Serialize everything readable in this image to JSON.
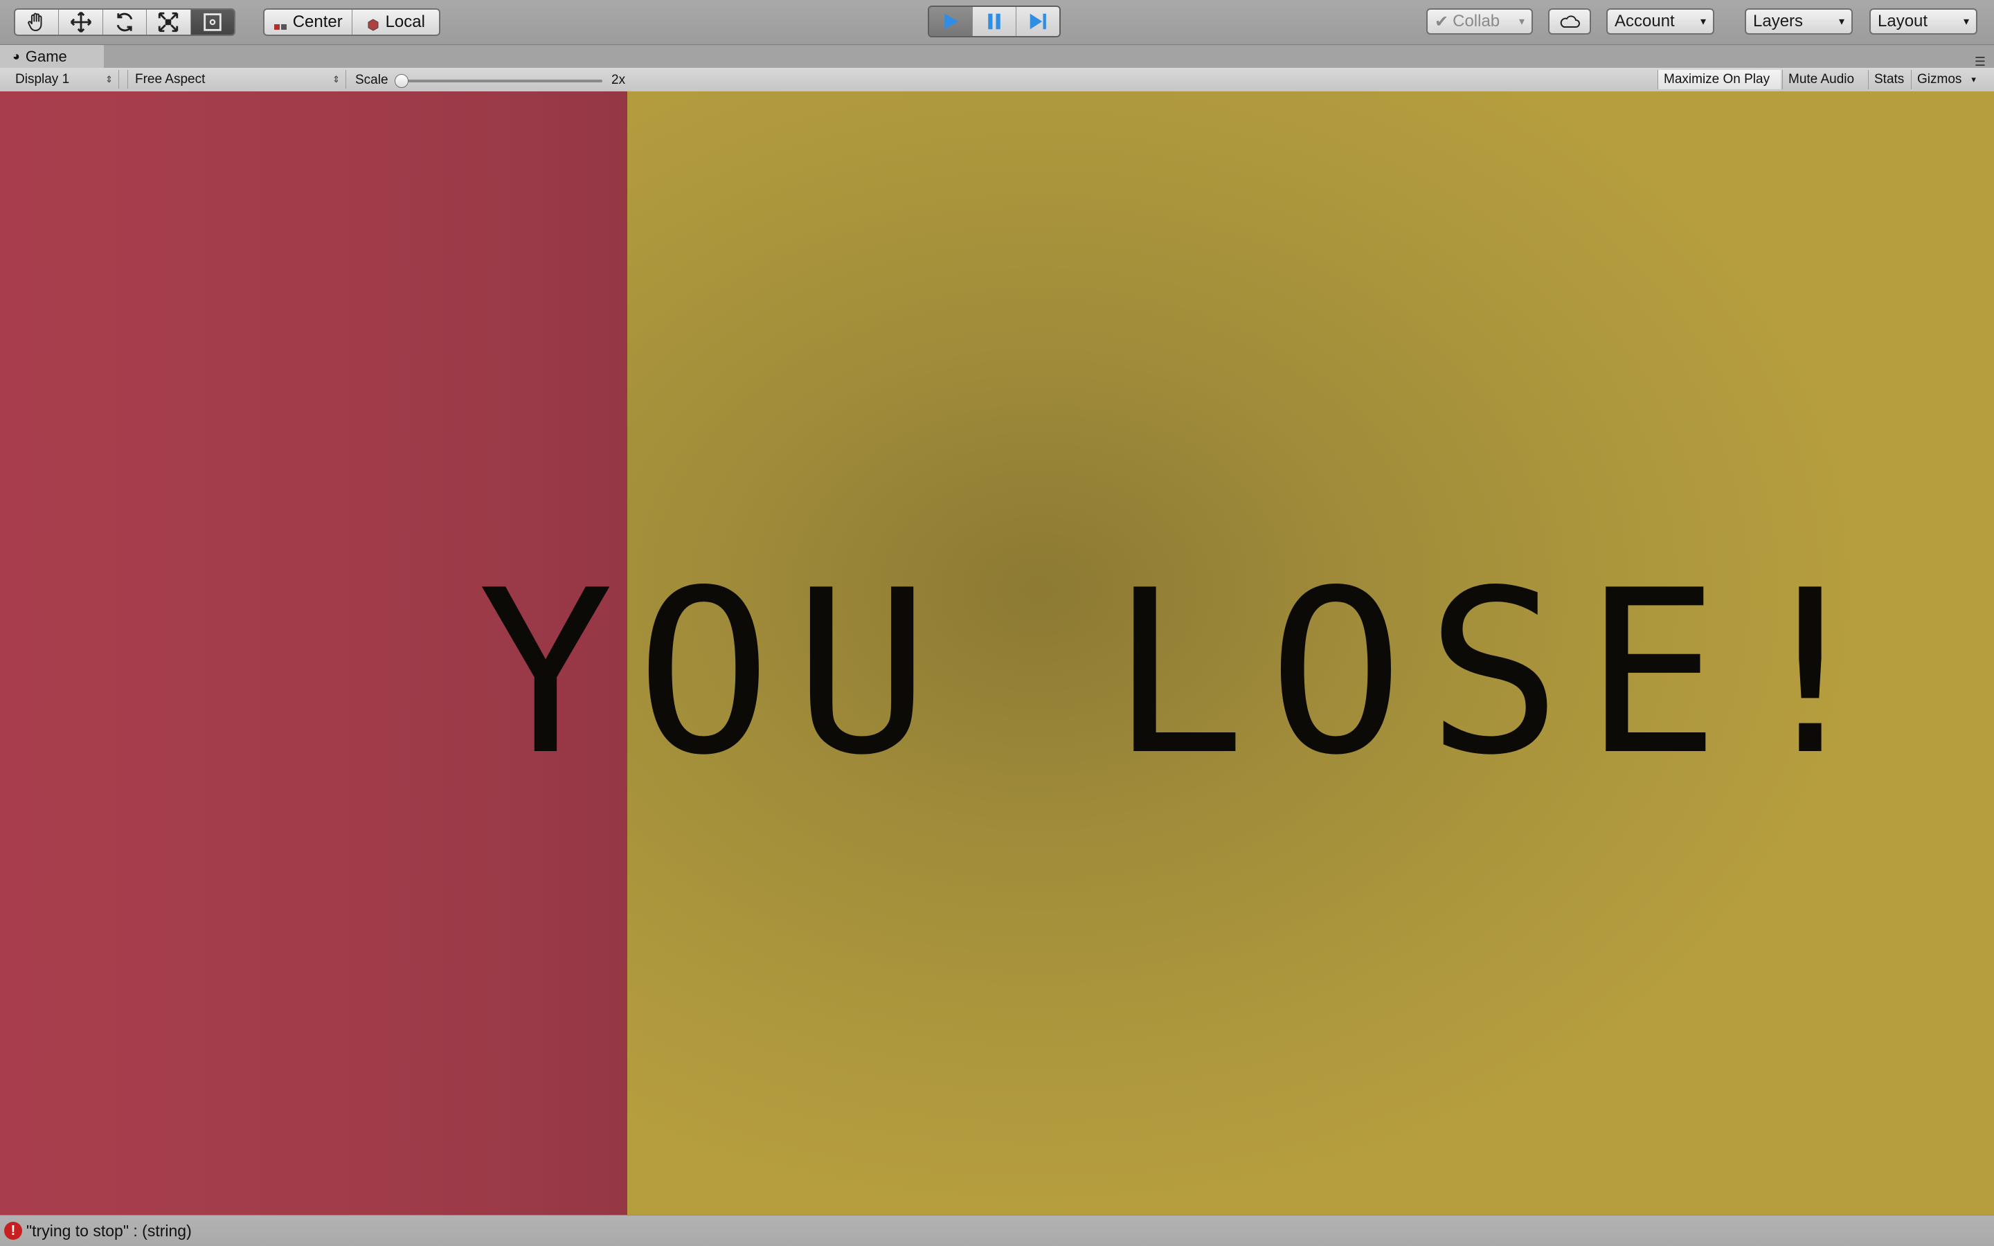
{
  "toolbar": {
    "tools": [
      "hand-icon",
      "move-icon",
      "rotate-icon",
      "scale-icon",
      "rect-tool-icon"
    ],
    "pivot_center": "Center",
    "pivot_local": "Local",
    "collab": "Collab",
    "account": "Account",
    "layers": "Layers",
    "layout": "Layout"
  },
  "tab": {
    "title": "Game"
  },
  "game_toolbar": {
    "display": "Display 1",
    "aspect": "Free Aspect",
    "scale_label": "Scale",
    "scale_value": "2x",
    "maximize": "Maximize On Play",
    "mute": "Mute Audio",
    "stats": "Stats",
    "gizmos": "Gizmos"
  },
  "game_view": {
    "headline": "YOU LOSE!",
    "left_panel_color": "#a03c4a",
    "background_color": "#ae983d"
  },
  "status": {
    "message": "\"trying to stop\" : (string)"
  },
  "colors": {
    "accent": "#2f8de4",
    "error": "#c62020"
  }
}
